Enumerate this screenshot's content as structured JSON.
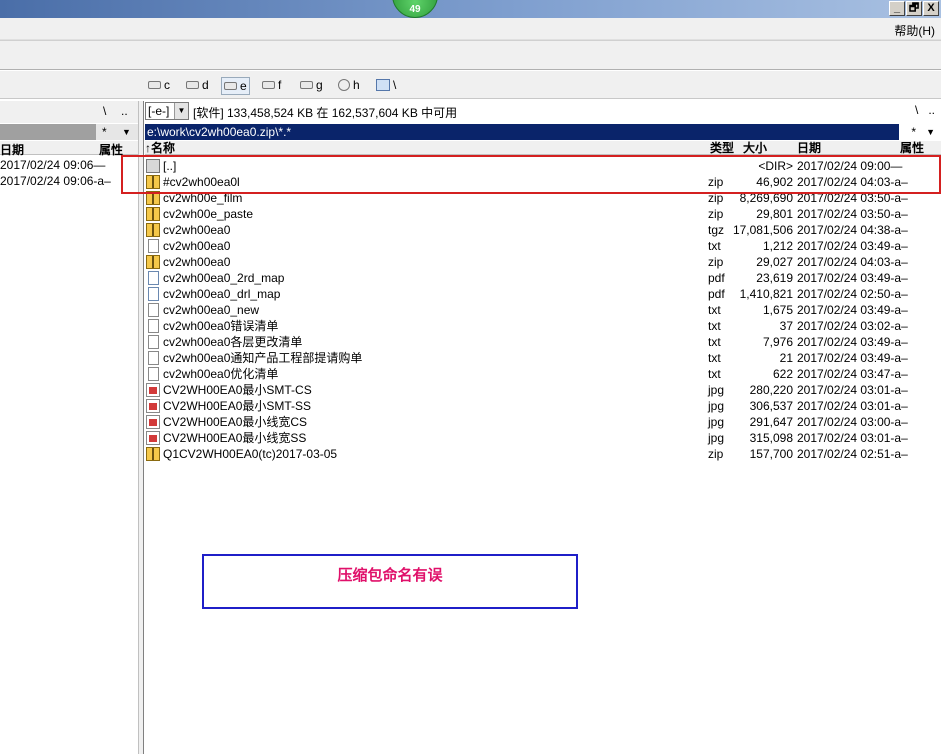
{
  "titlebar": {
    "badge": "49",
    "min": "_",
    "restore": "🗗",
    "close": "X"
  },
  "menu": {
    "help": "帮助(H)"
  },
  "drives": [
    {
      "label": "c"
    },
    {
      "label": "d"
    },
    {
      "label": "e"
    },
    {
      "label": "f"
    },
    {
      "label": "g"
    },
    {
      "label": "h"
    },
    {
      "label": "\\"
    }
  ],
  "left": {
    "root_btn": "\\",
    "up_btn": "..",
    "star_btn": "*",
    "arrow_btn": "▼",
    "header_date": "日期",
    "header_attr": "属性",
    "rows": [
      "2017/02/24 09:06—",
      "2017/02/24 09:06-a–"
    ]
  },
  "right": {
    "drive_select": "[-e-]",
    "free_space": "[软件]  133,458,524 KB 在 162,537,604 KB 中可用",
    "root_btn": "\\",
    "up_btn": "..",
    "path": "e:\\work\\cv2wh00ea0.zip\\*.*",
    "star_btn": "*",
    "arrow_btn": "▼",
    "headers": {
      "name": "↑名称",
      "type": "类型",
      "size": "大小",
      "date": "日期",
      "attr": "属性"
    },
    "files": [
      {
        "icon": "up",
        "name": "[..]",
        "ext": "",
        "size": "<DIR>",
        "date": "2017/02/24 09:00—",
        "attr": ""
      },
      {
        "icon": "zip",
        "name": "#cv2wh00ea0l",
        "ext": "zip",
        "size": "46,902",
        "date": "2017/02/24 04:03-a–",
        "attr": ""
      },
      {
        "icon": "zip",
        "name": "cv2wh00e_film",
        "ext": "zip",
        "size": "8,269,690",
        "date": "2017/02/24 03:50-a–",
        "attr": ""
      },
      {
        "icon": "zip",
        "name": "cv2wh00e_paste",
        "ext": "zip",
        "size": "29,801",
        "date": "2017/02/24 03:50-a–",
        "attr": ""
      },
      {
        "icon": "zip",
        "name": "cv2wh00ea0",
        "ext": "tgz",
        "size": "17,081,506",
        "date": "2017/02/24 04:38-a–",
        "attr": ""
      },
      {
        "icon": "txt",
        "name": "cv2wh00ea0",
        "ext": "txt",
        "size": "1,212",
        "date": "2017/02/24 03:49-a–",
        "attr": ""
      },
      {
        "icon": "zip",
        "name": "cv2wh00ea0",
        "ext": "zip",
        "size": "29,027",
        "date": "2017/02/24 04:03-a–",
        "attr": ""
      },
      {
        "icon": "pdf",
        "name": "cv2wh00ea0_2rd_map",
        "ext": "pdf",
        "size": "23,619",
        "date": "2017/02/24 03:49-a–",
        "attr": ""
      },
      {
        "icon": "pdf",
        "name": "cv2wh00ea0_drl_map",
        "ext": "pdf",
        "size": "1,410,821",
        "date": "2017/02/24 02:50-a–",
        "attr": ""
      },
      {
        "icon": "txt",
        "name": "cv2wh00ea0_new",
        "ext": "txt",
        "size": "1,675",
        "date": "2017/02/24 03:49-a–",
        "attr": ""
      },
      {
        "icon": "txt",
        "name": "cv2wh00ea0错误清单",
        "ext": "txt",
        "size": "37",
        "date": "2017/02/24 03:02-a–",
        "attr": ""
      },
      {
        "icon": "txt",
        "name": "cv2wh00ea0各层更改清单",
        "ext": "txt",
        "size": "7,976",
        "date": "2017/02/24 03:49-a–",
        "attr": ""
      },
      {
        "icon": "txt",
        "name": "cv2wh00ea0通知产品工程部提请购单",
        "ext": "txt",
        "size": "21",
        "date": "2017/02/24 03:49-a–",
        "attr": ""
      },
      {
        "icon": "txt",
        "name": "cv2wh00ea0优化清单",
        "ext": "txt",
        "size": "622",
        "date": "2017/02/24 03:47-a–",
        "attr": ""
      },
      {
        "icon": "jpg",
        "name": "CV2WH00EA0最小SMT-CS",
        "ext": "jpg",
        "size": "280,220",
        "date": "2017/02/24 03:01-a–",
        "attr": ""
      },
      {
        "icon": "jpg",
        "name": "CV2WH00EA0最小SMT-SS",
        "ext": "jpg",
        "size": "306,537",
        "date": "2017/02/24 03:01-a–",
        "attr": ""
      },
      {
        "icon": "jpg",
        "name": "CV2WH00EA0最小线宽CS",
        "ext": "jpg",
        "size": "291,647",
        "date": "2017/02/24 03:00-a–",
        "attr": ""
      },
      {
        "icon": "jpg",
        "name": "CV2WH00EA0最小线宽SS",
        "ext": "jpg",
        "size": "315,098",
        "date": "2017/02/24 03:01-a–",
        "attr": ""
      },
      {
        "icon": "zip",
        "name": "Q1CV2WH00EA0(tc)2017-03-05",
        "ext": "zip",
        "size": "157,700",
        "date": "2017/02/24 02:51-a–",
        "attr": ""
      }
    ]
  },
  "annotation": {
    "text": "压缩包命名有误",
    "text_color": "#e0106a",
    "box_color": "#1f1fc8",
    "highlight_color": "#d42020"
  }
}
